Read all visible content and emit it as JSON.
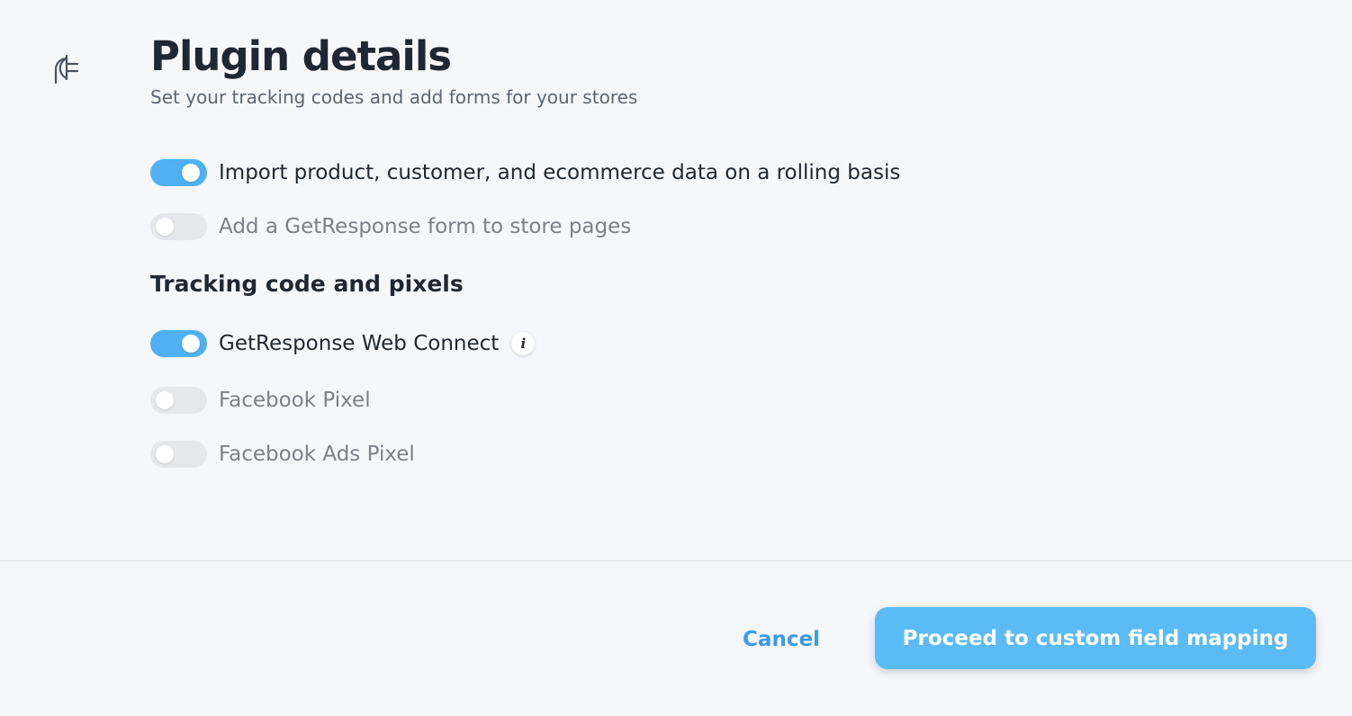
{
  "header": {
    "icon": "plug-icon",
    "title": "Plugin details",
    "subtitle": "Set your tracking codes and add forms for your stores"
  },
  "options": [
    {
      "label": "Import product, customer, and ecommerce data on a rolling basis",
      "enabled": true
    },
    {
      "label": "Add a GetResponse form to store pages",
      "enabled": false
    }
  ],
  "tracking": {
    "title": "Tracking code and pixels",
    "items": [
      {
        "label": "GetResponse Web Connect",
        "enabled": true,
        "info_icon": "i"
      },
      {
        "label": "Facebook Pixel",
        "enabled": false
      },
      {
        "label": "Facebook Ads Pixel",
        "enabled": false
      }
    ]
  },
  "footer": {
    "cancel_label": "Cancel",
    "proceed_label": "Proceed to custom field mapping"
  },
  "colors": {
    "accent": "#4fb1f1",
    "button": "#5bbcf5",
    "link": "#3a9be9",
    "background": "#f6f7fb"
  }
}
